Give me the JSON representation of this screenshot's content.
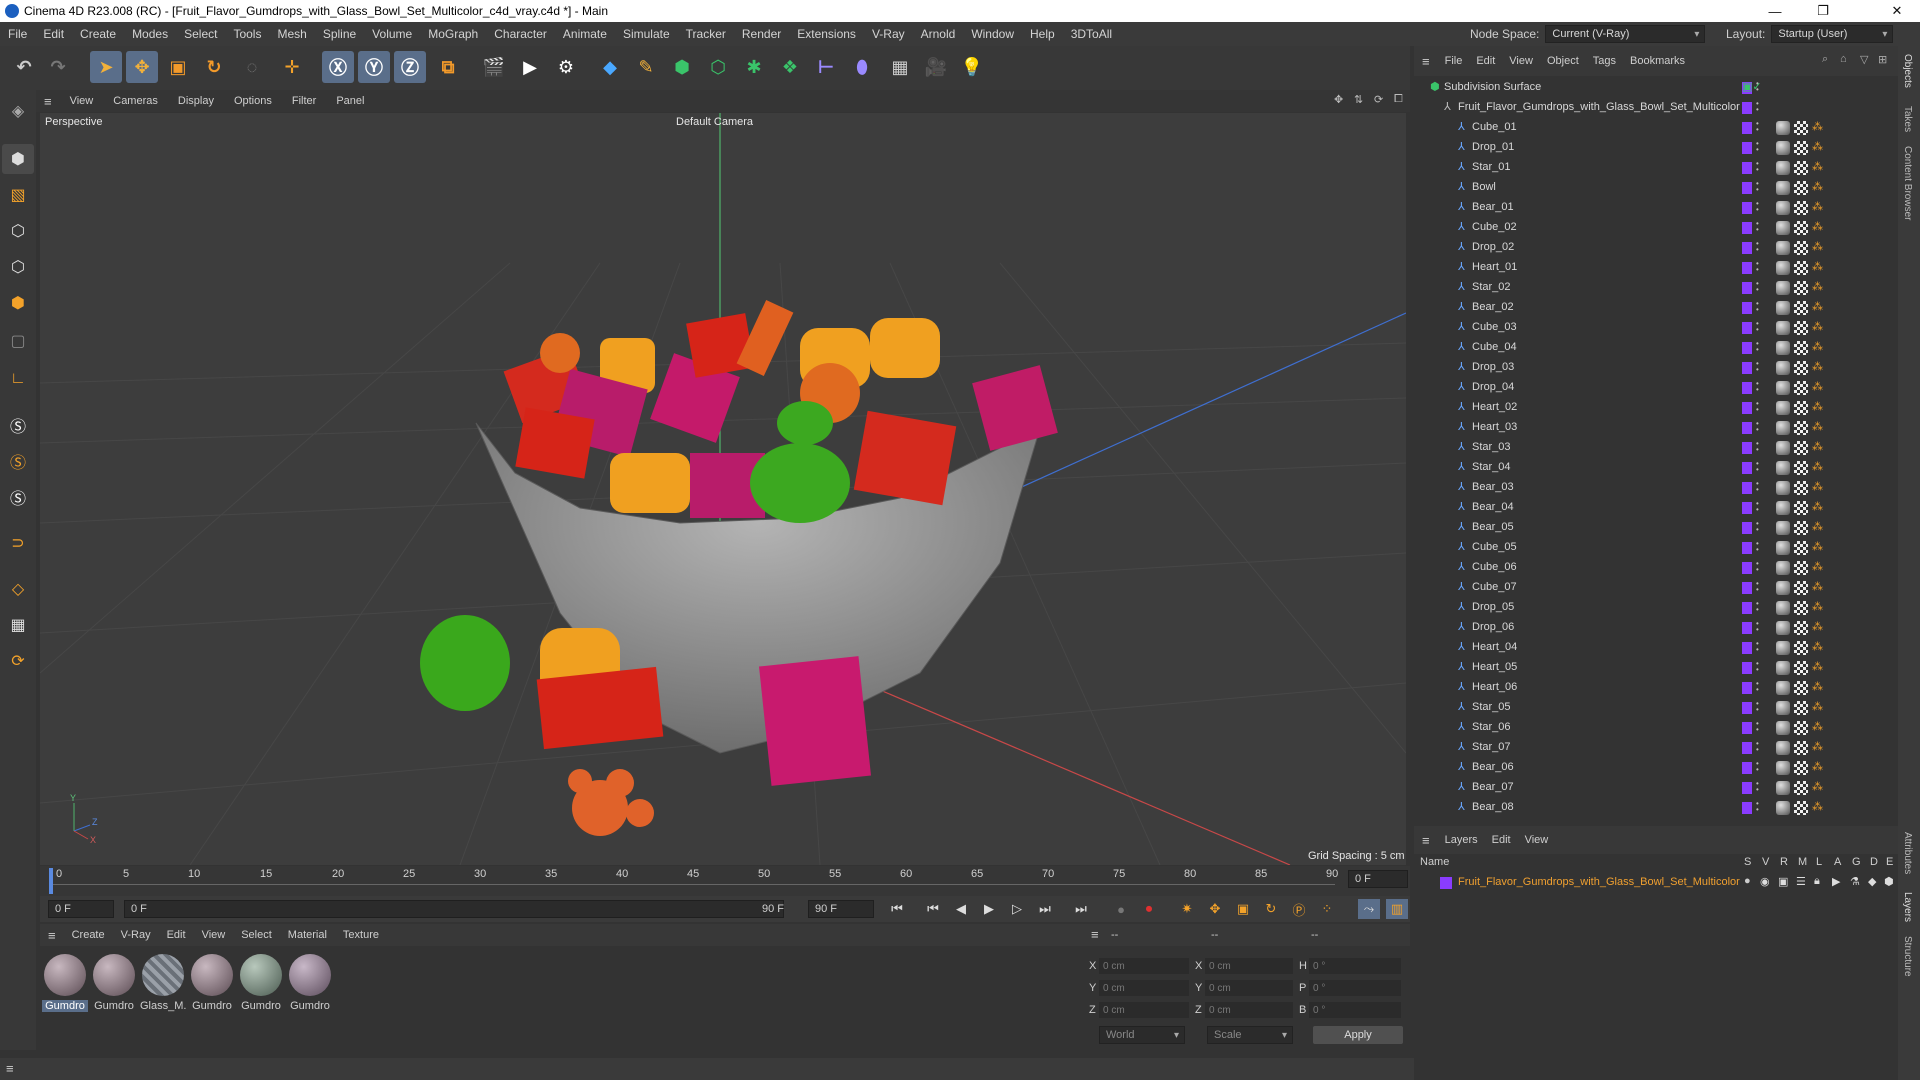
{
  "window": {
    "title": "Cinema 4D R23.008 (RC) - [Fruit_Flavor_Gumdrops_with_Glass_Bowl_Set_Multicolor_c4d_vray.c4d *] - Main",
    "controls": [
      "—",
      "❐",
      "✕"
    ]
  },
  "menubar": {
    "items": [
      "File",
      "Edit",
      "Create",
      "Modes",
      "Select",
      "Tools",
      "Mesh",
      "Spline",
      "Volume",
      "MoGraph",
      "Character",
      "Animate",
      "Simulate",
      "Tracker",
      "Render",
      "Extensions",
      "V-Ray",
      "Arnold",
      "Window",
      "Help",
      "3DToAll"
    ],
    "node_space_label": "Node Space:",
    "node_space_value": "Current (V-Ray)",
    "layout_label": "Layout:",
    "layout_value": "Startup (User)"
  },
  "viewport": {
    "menu": [
      "View",
      "Cameras",
      "Display",
      "Options",
      "Filter",
      "Panel"
    ],
    "view_name": "Perspective",
    "camera_name": "Default Camera",
    "grid_spacing": "Grid Spacing : 5 cm",
    "axis_y": "Y",
    "axis_z": "Z",
    "axis_x": "X"
  },
  "timeline": {
    "ticks": [
      "0",
      "5",
      "10",
      "15",
      "20",
      "25",
      "30",
      "35",
      "40",
      "45",
      "50",
      "55",
      "60",
      "65",
      "70",
      "75",
      "80",
      "85",
      "90"
    ],
    "current_frame": "0 F"
  },
  "transport": {
    "start": "0 F",
    "range_start": "0 F",
    "range_end": "90 F",
    "end": "90 F"
  },
  "material_manager": {
    "menu": [
      "Create",
      "V-Ray",
      "Edit",
      "View",
      "Select",
      "Material",
      "Texture"
    ],
    "materials": [
      {
        "name": "Gumdro",
        "color": "#7a6a70",
        "selected": true
      },
      {
        "name": "Gumdro",
        "color": "#7a6a72"
      },
      {
        "name": "Glass_M.",
        "color": "#8a9098"
      },
      {
        "name": "Gumdro",
        "color": "#786870"
      },
      {
        "name": "Gumdro",
        "color": "#6a7a70"
      },
      {
        "name": "Gumdro",
        "color": "#7a6a78"
      }
    ]
  },
  "coordinates": {
    "header": [
      "--",
      "--",
      "--"
    ],
    "rows": [
      {
        "a": "X",
        "av": "0 cm",
        "b": "X",
        "bv": "0 cm",
        "c": "H",
        "cv": "0 °"
      },
      {
        "a": "Y",
        "av": "0 cm",
        "b": "Y",
        "bv": "0 cm",
        "c": "P",
        "cv": "0 °"
      },
      {
        "a": "Z",
        "av": "0 cm",
        "b": "Z",
        "bv": "0 cm",
        "c": "B",
        "cv": "0 °"
      }
    ],
    "world": "World",
    "scale": "Scale",
    "apply": "Apply"
  },
  "object_manager": {
    "menu": [
      "File",
      "Edit",
      "View",
      "Object",
      "Tags",
      "Bookmarks"
    ],
    "root": "Subdivision Surface",
    "group": "Fruit_Flavor_Gumdrops_with_Glass_Bowl_Set_Multicolor",
    "objects": [
      "Cube_01",
      "Drop_01",
      "Star_01",
      "Bowl",
      "Bear_01",
      "Cube_02",
      "Drop_02",
      "Heart_01",
      "Star_02",
      "Bear_02",
      "Cube_03",
      "Cube_04",
      "Drop_03",
      "Drop_04",
      "Heart_02",
      "Heart_03",
      "Star_03",
      "Star_04",
      "Bear_03",
      "Bear_04",
      "Bear_05",
      "Cube_05",
      "Cube_06",
      "Cube_07",
      "Drop_05",
      "Drop_06",
      "Heart_04",
      "Heart_05",
      "Heart_06",
      "Star_05",
      "Star_06",
      "Star_07",
      "Bear_06",
      "Bear_07",
      "Bear_08"
    ]
  },
  "layers": {
    "menu": [
      "Layers",
      "Edit",
      "View"
    ],
    "columns": [
      "Name",
      "S",
      "V",
      "R",
      "M",
      "L",
      "A",
      "G",
      "D",
      "E"
    ],
    "items": [
      {
        "name": "Fruit_Flavor_Gumdrops_with_Glass_Bowl_Set_Multicolor"
      }
    ]
  },
  "right_tabs": [
    "Objects",
    "Takes",
    "Content Browser"
  ],
  "right_tabs_lower": [
    "Attributes",
    "Layers",
    "Structure"
  ],
  "colors": {
    "accent": "#5a6e8a",
    "layer_color": "#8a3cff",
    "selected_text": "#f0a030"
  }
}
